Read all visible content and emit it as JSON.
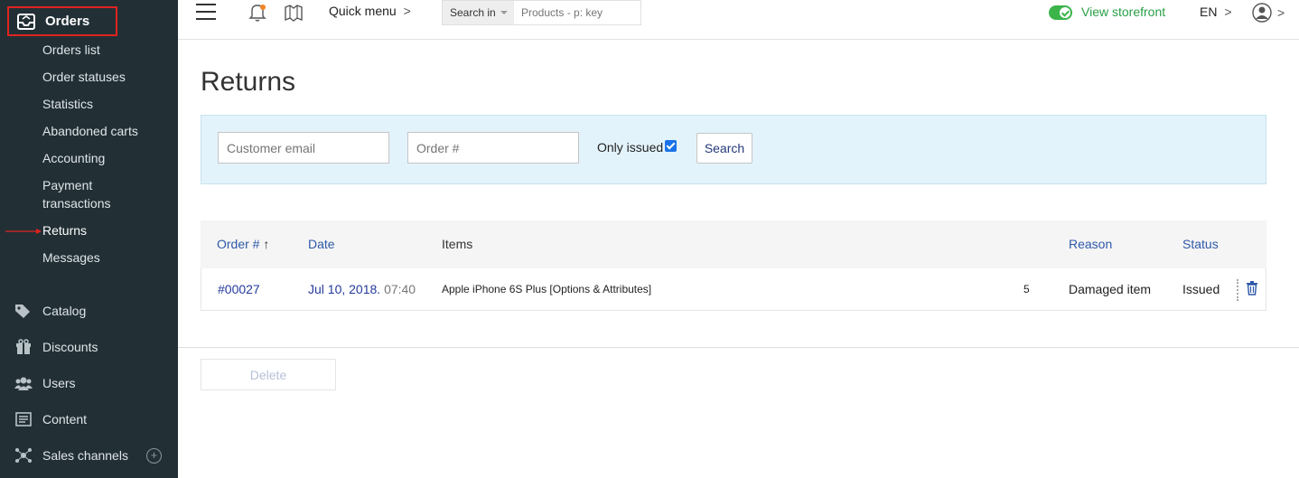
{
  "sidebar": {
    "active_section": "Orders",
    "sub_items": [
      "Orders list",
      "Order statuses",
      "Statistics",
      "Abandoned carts",
      "Accounting",
      "Payment",
      "transactions",
      "Returns",
      "Messages"
    ],
    "main_items": [
      {
        "label": "Catalog",
        "icon": "tag-icon"
      },
      {
        "label": "Discounts",
        "icon": "gift-icon"
      },
      {
        "label": "Users",
        "icon": "users-icon"
      },
      {
        "label": "Content",
        "icon": "content-icon"
      },
      {
        "label": "Sales channels",
        "icon": "network-icon"
      }
    ],
    "plus_glyph": "+"
  },
  "topbar": {
    "quick_menu": "Quick menu",
    "search_in": "Search in",
    "search_placeholder": "Products - p: key",
    "view_storefront": "View storefront",
    "lang": "EN",
    "chevron": ">"
  },
  "page": {
    "title": "Returns"
  },
  "filter": {
    "email_placeholder": "Customer email",
    "order_placeholder": "Order #",
    "only_issued": "Only issued",
    "only_issued_checked": true,
    "search_button": "Search"
  },
  "table": {
    "headers": {
      "order": "Order #",
      "sort_arrow": "↑",
      "date": "Date",
      "items": "Items",
      "reason": "Reason",
      "status": "Status"
    },
    "rows": [
      {
        "order": "#00027",
        "date": "Jul 10, 2018.",
        "time": "07:40",
        "item": "Apple iPhone 6S Plus [Options & Attributes]",
        "qty": "5",
        "reason": "Damaged item",
        "status": "Issued"
      }
    ]
  },
  "actions": {
    "delete": "Delete"
  },
  "colors": {
    "sidebar_bg": "#223036",
    "highlight": "#e0231f",
    "link": "#253a9c",
    "storefront_green": "#2aa048",
    "filter_bg": "#e3f3fb"
  }
}
